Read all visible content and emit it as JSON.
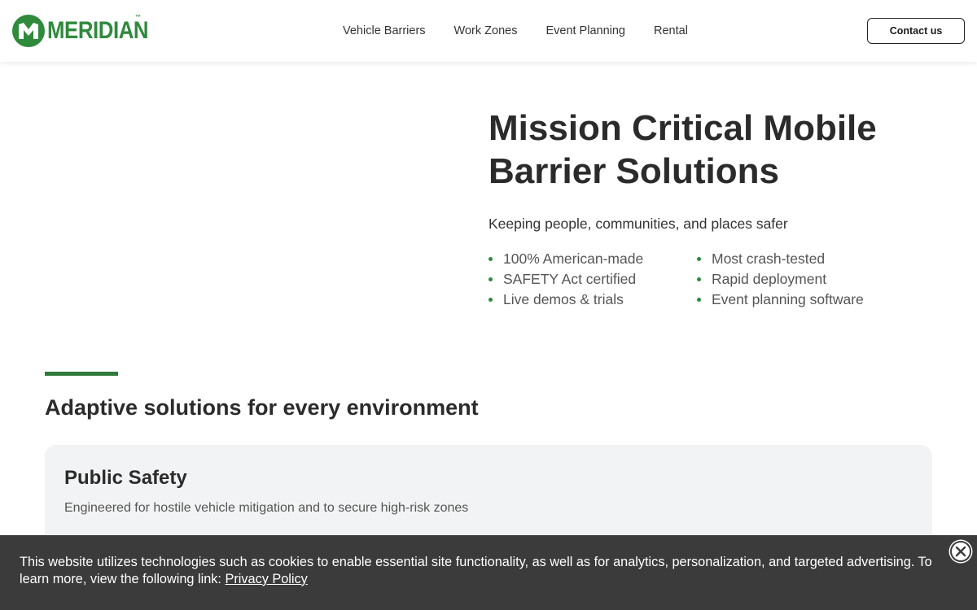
{
  "brand": {
    "name": "MERIDIAN",
    "tm": "™",
    "color": "#2f8a3c"
  },
  "nav": {
    "items": [
      {
        "label": "Vehicle Barriers"
      },
      {
        "label": "Work Zones"
      },
      {
        "label": "Event Planning"
      },
      {
        "label": "Rental"
      }
    ],
    "contact_label": "Contact us"
  },
  "hero": {
    "title_line1": "Mission Critical Mobile",
    "title_line2": "Barrier Solutions",
    "subtitle": "Keeping people, communities, and places safer",
    "features": [
      "100% American-made",
      "Most crash-tested",
      "SAFETY Act certified",
      "Rapid deployment",
      "Live demos & trials",
      "Event planning software"
    ]
  },
  "section": {
    "title": "Adaptive solutions for every environment",
    "accent_color": "#2f7a3a"
  },
  "card": {
    "title": "Public Safety",
    "description": "Engineered for hostile vehicle mitigation and to secure high-risk zones"
  },
  "cookie_banner": {
    "text": "This website utilizes technologies such as cookies to enable essential site functionality, as well as for analytics, personalization, and targeted advertising. To learn more, view the following link: ",
    "link_label": "Privacy Policy",
    "close_icon": "close-icon"
  }
}
